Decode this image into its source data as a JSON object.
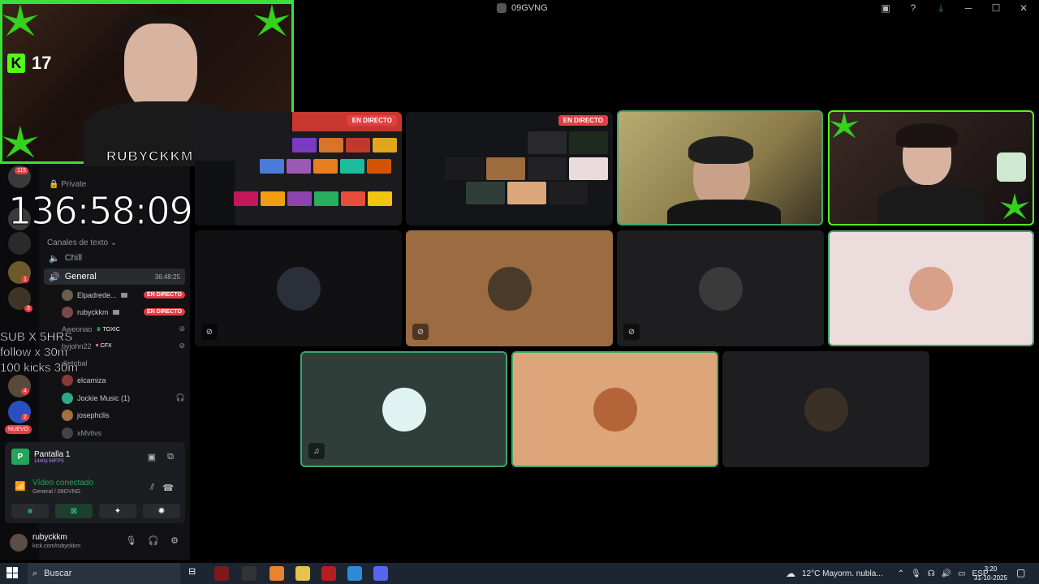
{
  "window": {
    "title": "09GVNG"
  },
  "stream": {
    "kick_count": "17",
    "cam_name": "RUBYCKKM",
    "timer": "136:58:09",
    "promo": [
      "SUB X 5HRS",
      "follow x 30m",
      "100 kicks 30m"
    ]
  },
  "sidebar": {
    "private_label": "Private",
    "text_channels": "Canales de texto",
    "channels": [
      {
        "name": "Chill"
      },
      {
        "name": "General",
        "time": "36:48:25"
      }
    ],
    "users": [
      {
        "name": "Elpadrede...",
        "status": "EN DIRECTO"
      },
      {
        "name": "rubyckkm",
        "status": "EN DIRECTO"
      },
      {
        "name": "Aweonao",
        "tag": "TOXIC"
      },
      {
        "name": "byjohn22",
        "tag": "CFX"
      },
      {
        "name": "dietobal"
      },
      {
        "name": "elcamiza"
      },
      {
        "name": "Jockie Music (1)"
      },
      {
        "name": "josephclis"
      },
      {
        "name": "xMvtivs"
      }
    ],
    "rail_badges": [
      "115",
      "1",
      "3",
      "4",
      "2"
    ],
    "nuevo": "NUEVO"
  },
  "voice": {
    "screen_name": "Pantalla 1",
    "screen_sub": "1440p 60FPS",
    "connected": "Vídeo conectado",
    "channel_path": "General / 09GVNG"
  },
  "user": {
    "name": "rubyckkm",
    "sub": "kick.com/rubyckkm"
  },
  "tiles": {
    "live_label": "EN DIRECTO"
  },
  "taskbar": {
    "search": "Buscar",
    "weather": "12°C  Mayorm. nubla...",
    "lang": "ESP",
    "time": "3:20",
    "date": "31-10-2025"
  }
}
